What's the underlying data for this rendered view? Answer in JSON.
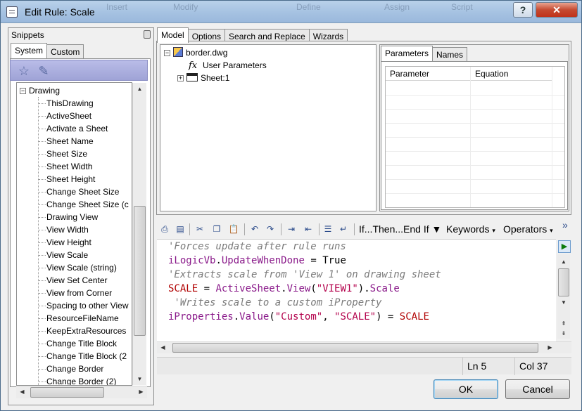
{
  "window": {
    "title": "Edit Rule: Scale",
    "ghost_menu": [
      "Insert",
      "Modify",
      "Define",
      "Assign",
      "Script"
    ],
    "help_glyph": "?",
    "close_glyph": "✕"
  },
  "snippets": {
    "header": "Snippets",
    "tabs": [
      {
        "label": "System",
        "active": true
      },
      {
        "label": "Custom",
        "active": false
      }
    ],
    "toolbar_icons": [
      "add-star-icon",
      "edit-star-icon"
    ],
    "root": {
      "label": "Drawing",
      "expander": "−"
    },
    "items": [
      "ThisDrawing",
      "ActiveSheet",
      "Activate a Sheet",
      "Sheet Name",
      "Sheet Size",
      "Sheet Width",
      "Sheet Height",
      "Change Sheet Size",
      "Change Sheet Size (c",
      "Drawing View",
      "View Width",
      "View Height",
      "View Scale",
      "View Scale (string)",
      "View Set Center",
      "View from Corner",
      "Spacing to other View",
      "ResourceFileName",
      "KeepExtraResources",
      "Change Title Block",
      "Change Title Block (2",
      "Change Border",
      "Change Border (2)"
    ]
  },
  "main_tabs": [
    {
      "label": "Model",
      "active": true
    },
    {
      "label": "Options",
      "active": false
    },
    {
      "label": "Search and Replace",
      "active": false
    },
    {
      "label": "Wizards",
      "active": false
    }
  ],
  "model_tree": {
    "root": "border.dwg",
    "children": [
      {
        "label": "User Parameters",
        "icon": "fx-icon"
      },
      {
        "label": "Sheet:1",
        "icon": "sheet-icon",
        "expander": "+"
      }
    ]
  },
  "param_tabs": [
    {
      "label": "Parameters",
      "active": true
    },
    {
      "label": "Names",
      "active": false
    }
  ],
  "param_grid": {
    "columns": [
      "Parameter",
      "Equation"
    ],
    "rows": []
  },
  "editor_toolbar": {
    "icons": [
      "print-icon",
      "print-preview-icon",
      "cut-icon",
      "copy-icon",
      "paste-icon",
      "undo-icon",
      "redo-icon",
      "indent-icon",
      "outdent-icon",
      "comment-icon",
      "uncomment-icon"
    ],
    "menus": [
      "If...Then...End If",
      "Keywords",
      "Operators"
    ],
    "overflow": "»"
  },
  "code": [
    [
      {
        "t": "'Forces update after rule runs",
        "c": "com"
      }
    ],
    [
      {
        "t": "iLogicVb",
        "c": "kw"
      },
      {
        "t": ".",
        "c": "op"
      },
      {
        "t": "UpdateWhenDone",
        "c": "kw"
      },
      {
        "t": " = ",
        "c": "op"
      },
      {
        "t": "True",
        "c": "lit"
      }
    ],
    [
      {
        "t": "'Extracts scale from 'View 1' on drawing sheet",
        "c": "com"
      }
    ],
    [
      {
        "t": "SCALE",
        "c": "var"
      },
      {
        "t": " = ",
        "c": "op"
      },
      {
        "t": "ActiveSheet",
        "c": "kw"
      },
      {
        "t": ".",
        "c": "op"
      },
      {
        "t": "View",
        "c": "kw"
      },
      {
        "t": "(",
        "c": "op"
      },
      {
        "t": "\"VIEW1\"",
        "c": "str"
      },
      {
        "t": ").",
        "c": "op"
      },
      {
        "t": "Scale",
        "c": "kw"
      }
    ],
    [
      {
        "t": " 'Writes scale to a custom iProperty",
        "c": "com"
      }
    ],
    [
      {
        "t": "iProperties",
        "c": "kw"
      },
      {
        "t": ".",
        "c": "op"
      },
      {
        "t": "Value",
        "c": "kw"
      },
      {
        "t": "(",
        "c": "op"
      },
      {
        "t": "\"Custom\"",
        "c": "str"
      },
      {
        "t": ", ",
        "c": "op"
      },
      {
        "t": "\"SCALE\"",
        "c": "str"
      },
      {
        "t": ") = ",
        "c": "op"
      },
      {
        "t": "SCALE",
        "c": "var"
      }
    ]
  ],
  "status": {
    "line": "Ln 5",
    "col": "Col 37"
  },
  "buttons": {
    "ok": "OK",
    "cancel": "Cancel"
  },
  "colors": {
    "keyword": "#8a1a8a",
    "string": "#b3004b",
    "comment": "#7b7b7b",
    "variable": "#b00000"
  }
}
